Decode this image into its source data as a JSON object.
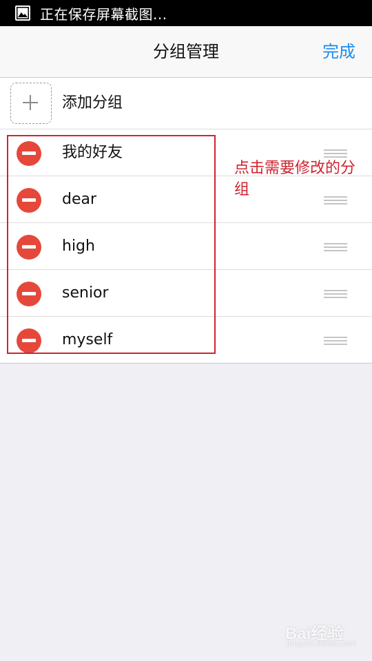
{
  "status_bar": {
    "text": "正在保存屏幕截图...",
    "icon": "image-icon"
  },
  "nav": {
    "title": "分组管理",
    "done_label": "完成",
    "done_color": "#1a8cf0"
  },
  "add_group": {
    "label": "添加分组",
    "icon": "plus-icon"
  },
  "groups": [
    {
      "name": "我的好友"
    },
    {
      "name": "dear"
    },
    {
      "name": "high"
    },
    {
      "name": "senior"
    },
    {
      "name": "myself"
    }
  ],
  "annotation": {
    "text": "点击需要修改的分组",
    "color": "#d0232e"
  },
  "watermark": {
    "logo": "Bai经验",
    "sub": "jingyan.baidu.com"
  },
  "colors": {
    "delete": "#e5483b",
    "background": "#efeff4"
  }
}
